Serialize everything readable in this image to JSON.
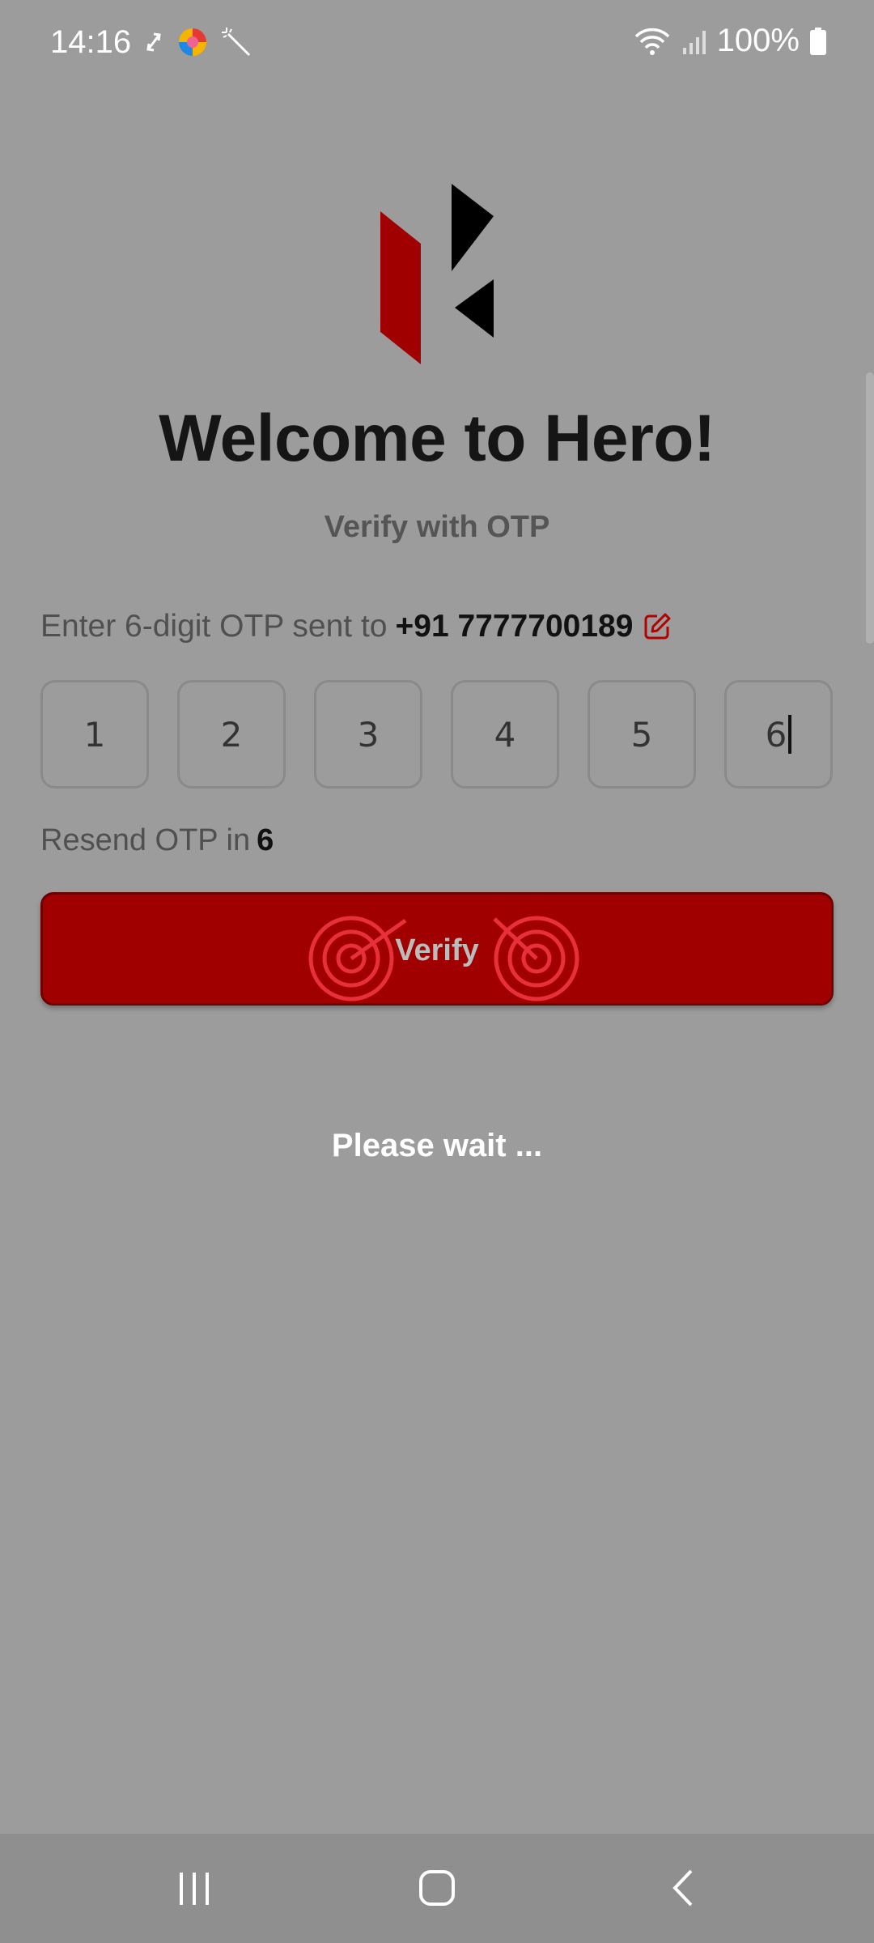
{
  "status_bar": {
    "time": "14:16",
    "battery": "100%"
  },
  "brand": {
    "accent_color": "#a10000"
  },
  "header": {
    "title": "Welcome to Hero!",
    "subtitle": "Verify with OTP"
  },
  "otp": {
    "prompt": "Enter 6-digit OTP sent to",
    "phone": "+91 7777700189",
    "digits": [
      "1",
      "2",
      "3",
      "4",
      "5",
      "6"
    ]
  },
  "resend": {
    "label": "Resend OTP in",
    "countdown": "6"
  },
  "actions": {
    "verify_label": "Verify"
  },
  "loading": {
    "message": "Please wait ..."
  },
  "icons": {
    "edit": "edit-icon",
    "recents": "recents-icon",
    "home": "home-icon",
    "back": "back-icon"
  }
}
